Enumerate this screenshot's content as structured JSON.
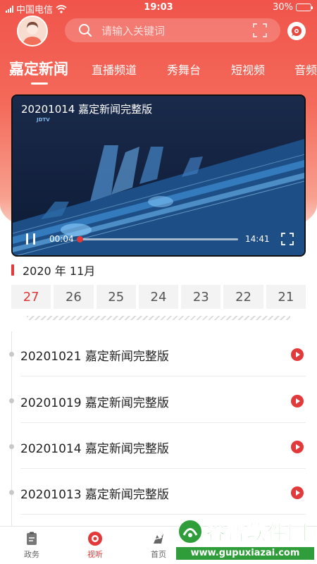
{
  "status_bar": {
    "carrier": "中国电信",
    "time": "19:03",
    "battery": "30%",
    "battery_level": 0.3
  },
  "header": {
    "search_placeholder": "请输入关键词"
  },
  "tabs": [
    {
      "label": "嘉定新闻",
      "active": true
    },
    {
      "label": "直播频道",
      "active": false
    },
    {
      "label": "秀舞台",
      "active": false
    },
    {
      "label": "短视频",
      "active": false
    },
    {
      "label": "音频",
      "active": false
    }
  ],
  "video": {
    "title": "20201014 嘉定新闻完整版",
    "logo": "JDTV",
    "current_time": "00:04",
    "duration": "14:41",
    "progress": 0.005
  },
  "date_picker": {
    "month": "2020 年 11月",
    "days": [
      "27",
      "26",
      "25",
      "24",
      "23",
      "22",
      "21"
    ],
    "selected": "27"
  },
  "news_list": [
    {
      "title": "20201021 嘉定新闻完整版"
    },
    {
      "title": "20201019 嘉定新闻完整版"
    },
    {
      "title": "20201014 嘉定新闻完整版"
    },
    {
      "title": "20201013 嘉定新闻完整版"
    }
  ],
  "bottom_nav": [
    {
      "label": "政务",
      "icon": "clipboard-icon",
      "active": false
    },
    {
      "label": "视听",
      "icon": "record-icon",
      "active": true
    },
    {
      "label": "首页",
      "icon": "home-icon",
      "active": false
    }
  ],
  "watermark": {
    "text": "谷普软件园",
    "url": "www.gupuxiazai.com"
  },
  "colors": {
    "accent": "#e23a3a",
    "header_gradient_top": "#f0544b",
    "watermark_green": "#2f9e3a"
  }
}
